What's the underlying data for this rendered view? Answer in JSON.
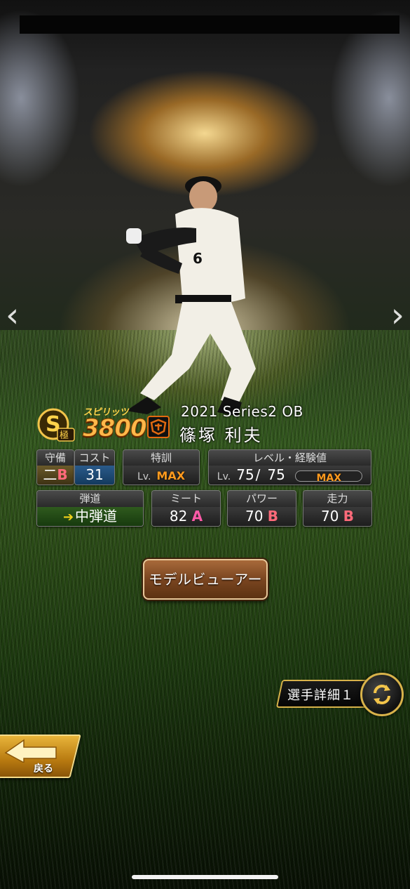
{
  "nav": {
    "prev_glyph": "‹",
    "next_glyph": "›"
  },
  "card": {
    "rank_badge_icon": "s-kiwami-rank-badge",
    "spirits_label": "スピリッツ",
    "spirits_value": "3800",
    "team_logo_icon": "giants-logo-icon",
    "series": "2021 Series2 OB",
    "player_name": "篠塚 利夫"
  },
  "stats": {
    "position": {
      "label": "守備",
      "value_prefix": "二",
      "grade": "B"
    },
    "cost": {
      "label": "コスト",
      "value": "31"
    },
    "training": {
      "label": "特訓",
      "lv": "Lv.",
      "value": "MAX"
    },
    "level": {
      "label": "レベル・経験値",
      "lv": "Lv.",
      "current": "75",
      "separator": "/",
      "max": "75",
      "bar_label": "MAX",
      "exp_fraction": 1.0
    },
    "trajectory": {
      "label": "弾道",
      "value": "中弾道"
    },
    "meet": {
      "label": "ミート",
      "value": "82",
      "grade": "A"
    },
    "power": {
      "label": "パワー",
      "value": "70",
      "grade": "B"
    },
    "speed": {
      "label": "走力",
      "value": "70",
      "grade": "B"
    }
  },
  "buttons": {
    "model_viewer": "モデルビューアー",
    "player_detail": "選手詳細１",
    "back": "戻る"
  },
  "colors": {
    "max": "#ff9a1e",
    "grade_b": "#ff6a7a",
    "grade_a": "#ff5aa8",
    "gold": "#d8b24a"
  }
}
